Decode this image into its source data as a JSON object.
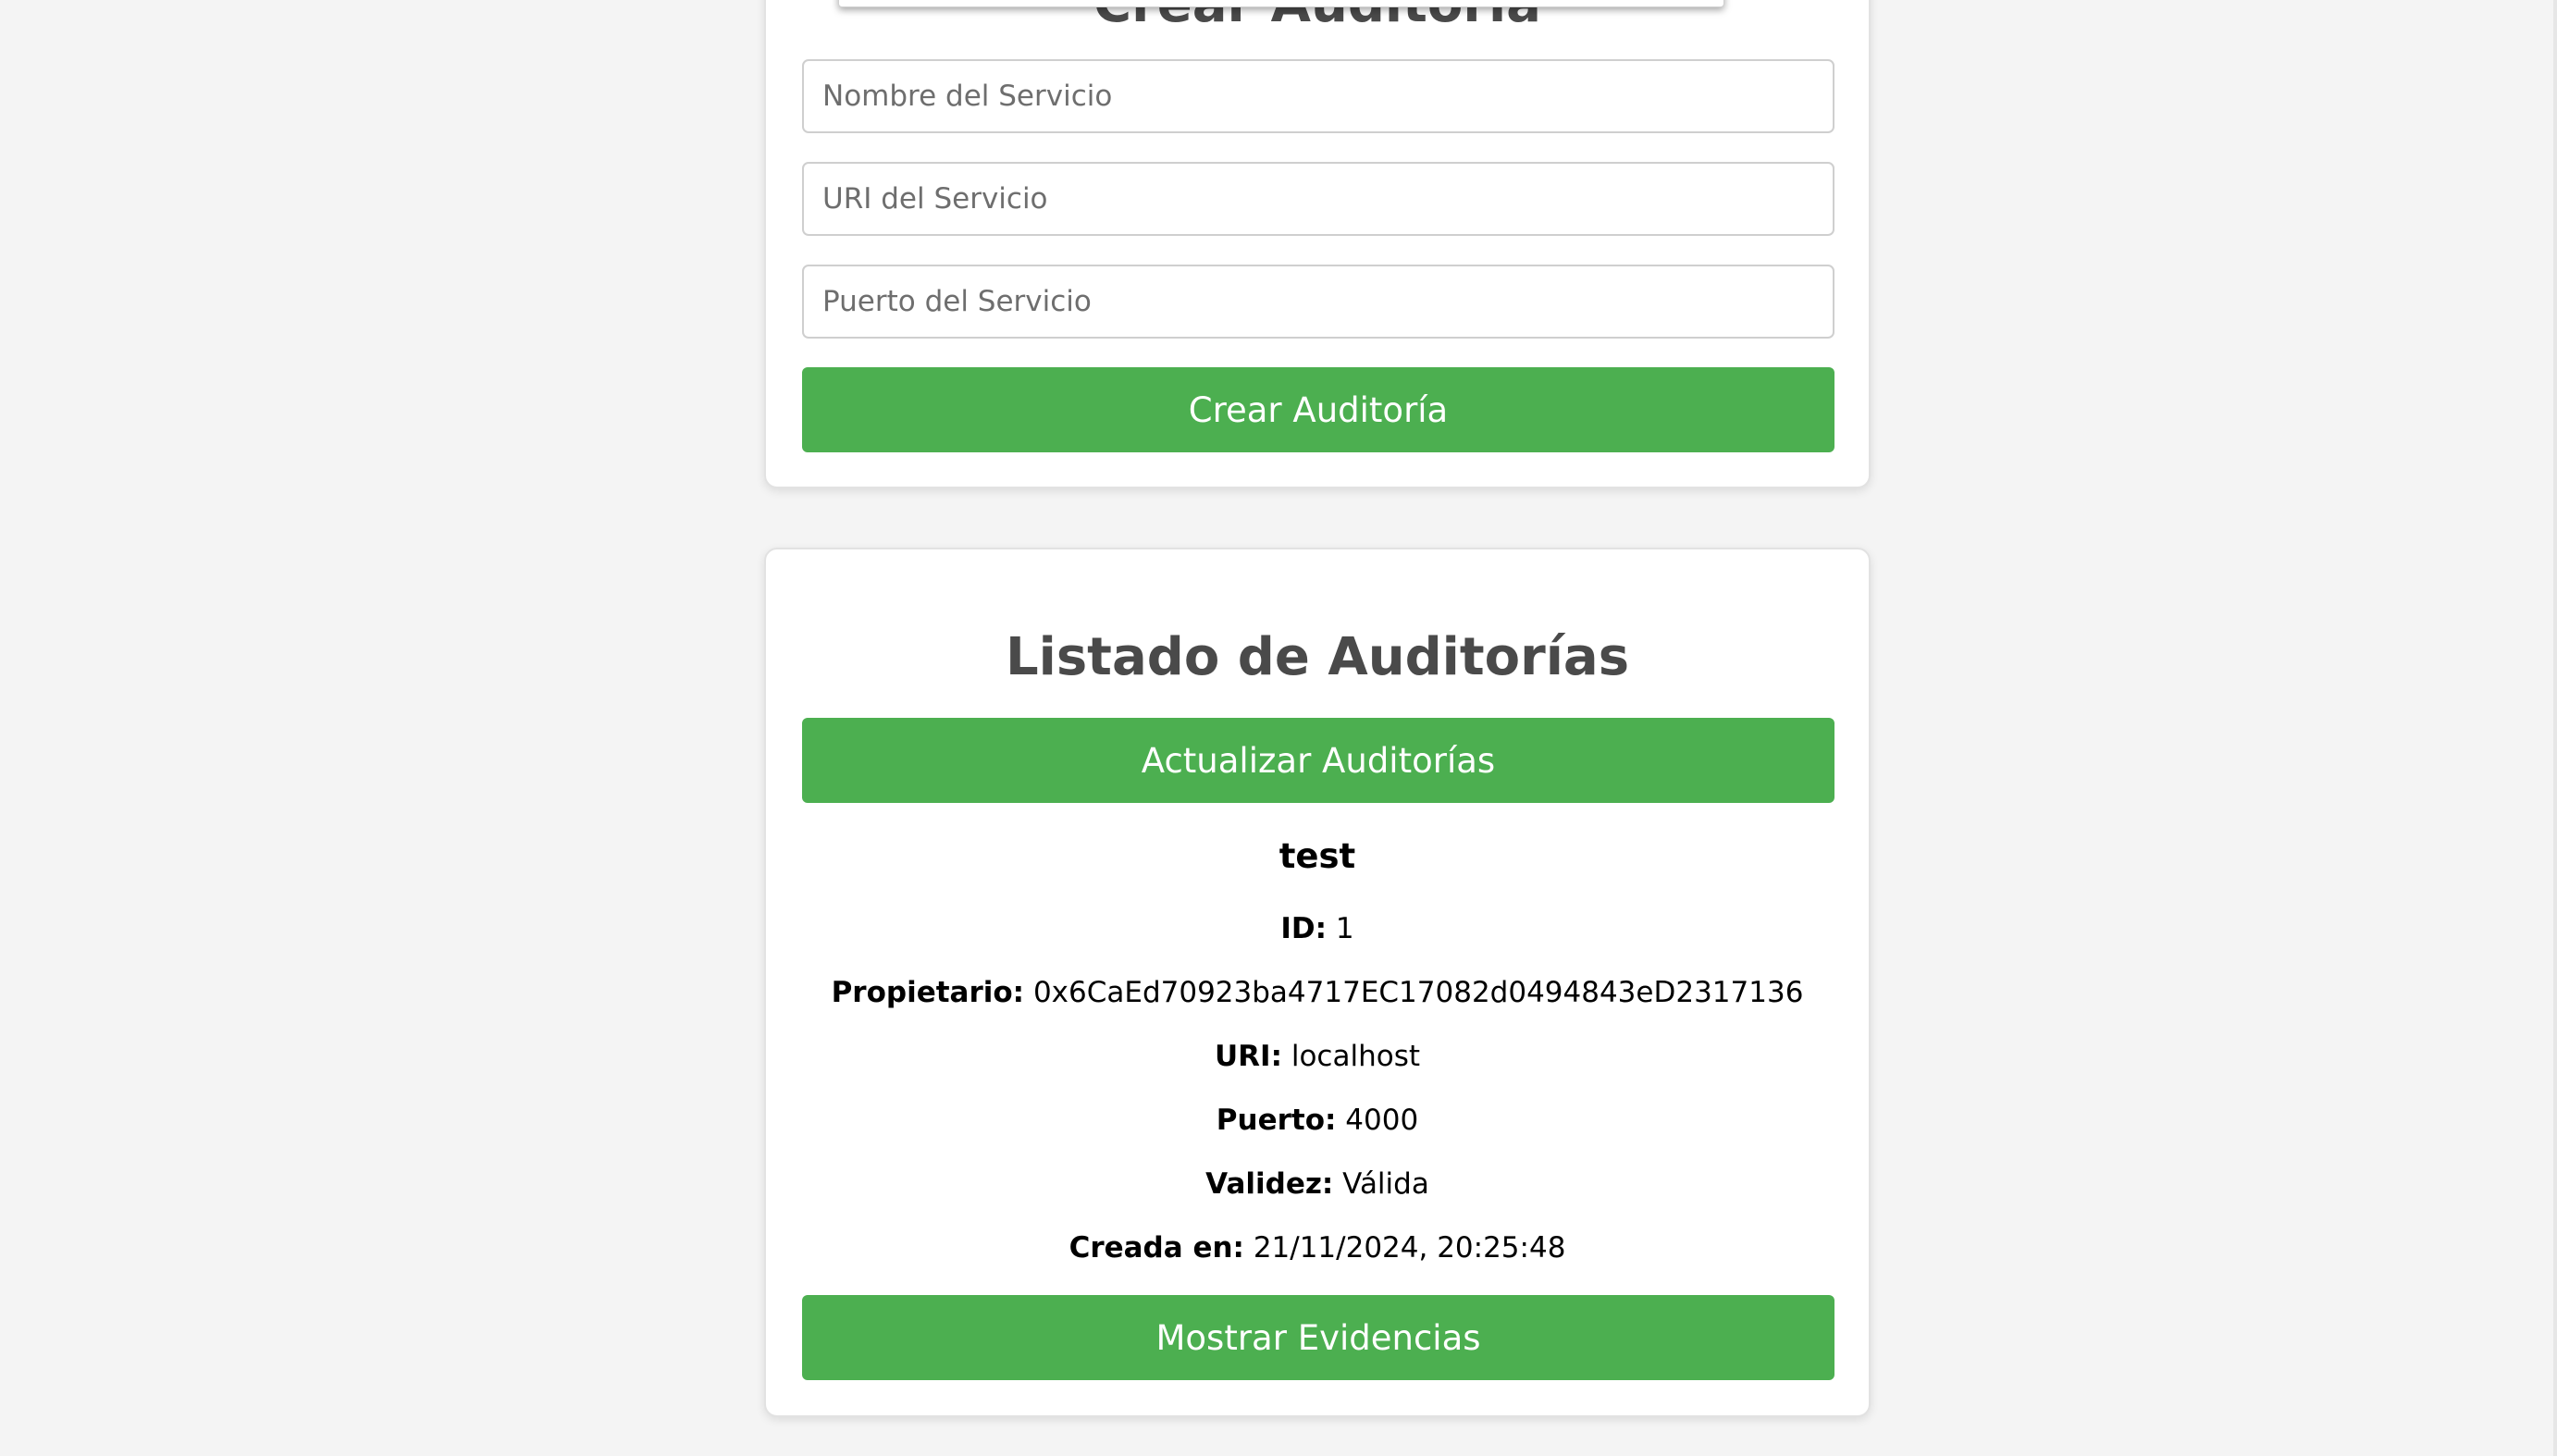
{
  "create_form": {
    "title": "Crear Auditoría",
    "fields": {
      "service_name_placeholder": "Nombre del Servicio",
      "service_uri_placeholder": "URI del Servicio",
      "service_port_placeholder": "Puerto del Servicio"
    },
    "submit_label": "Crear Auditoría"
  },
  "audit_list": {
    "title": "Listado de Auditorías",
    "refresh_label": "Actualizar Auditorías",
    "audits": [
      {
        "name": "test",
        "id_label": "ID:",
        "id": "1",
        "owner_label": "Propietario:",
        "owner": "0x6CaEd70923ba4717EC17082d0494843eD2317136",
        "uri_label": "URI:",
        "uri": "localhost",
        "port_label": "Puerto:",
        "port": "4000",
        "validity_label": "Validez:",
        "validity": "Válida",
        "created_label": "Creada en:",
        "created": "21/11/2024, 20:25:48",
        "evidence_label": "Mostrar Evidencias"
      }
    ]
  },
  "colors": {
    "accent": "#4caf50",
    "page_background": "#f4f4f4",
    "card_background": "#ffffff",
    "title_text": "#4a4a4a"
  }
}
